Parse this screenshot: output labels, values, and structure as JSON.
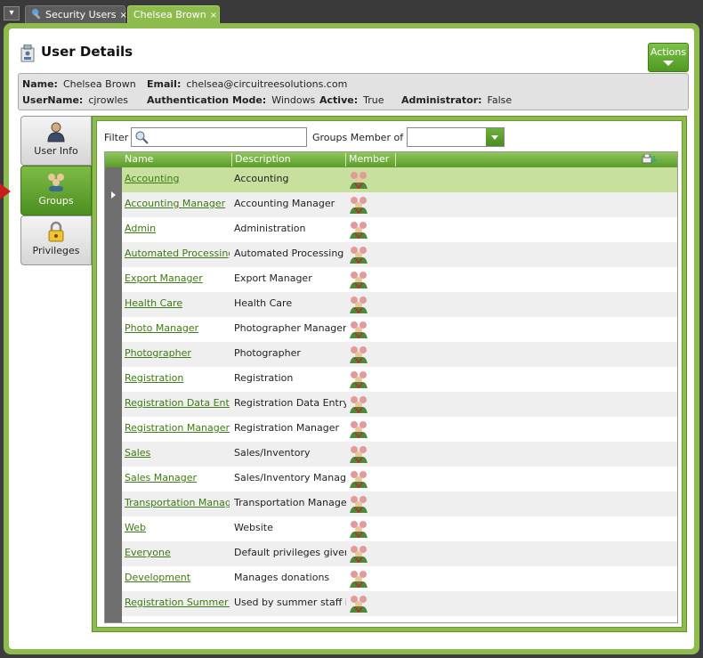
{
  "tabs": [
    {
      "label": "Security Users",
      "close": "×"
    },
    {
      "label": "Chelsea Brown",
      "close": "×"
    }
  ],
  "header": {
    "title": "User Details",
    "actions_label": "Actions"
  },
  "user": {
    "name_label": "Name:",
    "name": "Chelsea Brown",
    "email_label": "Email:",
    "email": "chelsea@circuitreesolutions.com",
    "username_label": "UserName:",
    "username": "cjrowles",
    "auth_label": "Authentication Mode:",
    "auth": "Windows",
    "active_label": "Active:",
    "active": "True",
    "admin_label": "Administrator:",
    "admin": "False"
  },
  "side_tabs": [
    {
      "label": "User Info",
      "icon": "user-icon"
    },
    {
      "label": "Groups",
      "icon": "groups-icon"
    },
    {
      "label": "Privileges",
      "icon": "lock-icon"
    }
  ],
  "filter": {
    "label": "Filter",
    "value": "",
    "groups_member_label": "Groups Member of",
    "groups_member_value": ""
  },
  "grid": {
    "columns": [
      "Name",
      "Description",
      "Member"
    ],
    "rows": [
      {
        "name": "Accounting",
        "description": "Accounting"
      },
      {
        "name": "Accounting Manager",
        "description": "Accounting Manager"
      },
      {
        "name": "Admin",
        "description": "Administration"
      },
      {
        "name": "Automated Processing",
        "description": "Automated Processing"
      },
      {
        "name": "Export Manager",
        "description": "Export Manager"
      },
      {
        "name": "Health Care",
        "description": "Health Care"
      },
      {
        "name": "Photo Manager",
        "description": "Photographer Manager"
      },
      {
        "name": "Photographer",
        "description": "Photographer"
      },
      {
        "name": "Registration",
        "description": "Registration"
      },
      {
        "name": "Registration Data Entry",
        "description": "Registration Data Entry"
      },
      {
        "name": "Registration Manager",
        "description": "Registration Manager"
      },
      {
        "name": "Sales",
        "description": "Sales/Inventory"
      },
      {
        "name": "Sales Manager",
        "description": "Sales/Inventory Manager"
      },
      {
        "name": "Transportation Manager",
        "description": "Transportation Manager"
      },
      {
        "name": "Web",
        "description": "Website"
      },
      {
        "name": "Everyone",
        "description": "Default privileges given..."
      },
      {
        "name": "Development",
        "description": "Manages donations"
      },
      {
        "name": "Registration Summer S...",
        "description": "Used by summer staff i..."
      }
    ]
  },
  "colors": {
    "accent": "#8dbb4e",
    "link": "#3e7a15",
    "selected_row": "#c8e09d",
    "indicator": "#c81d1d"
  }
}
